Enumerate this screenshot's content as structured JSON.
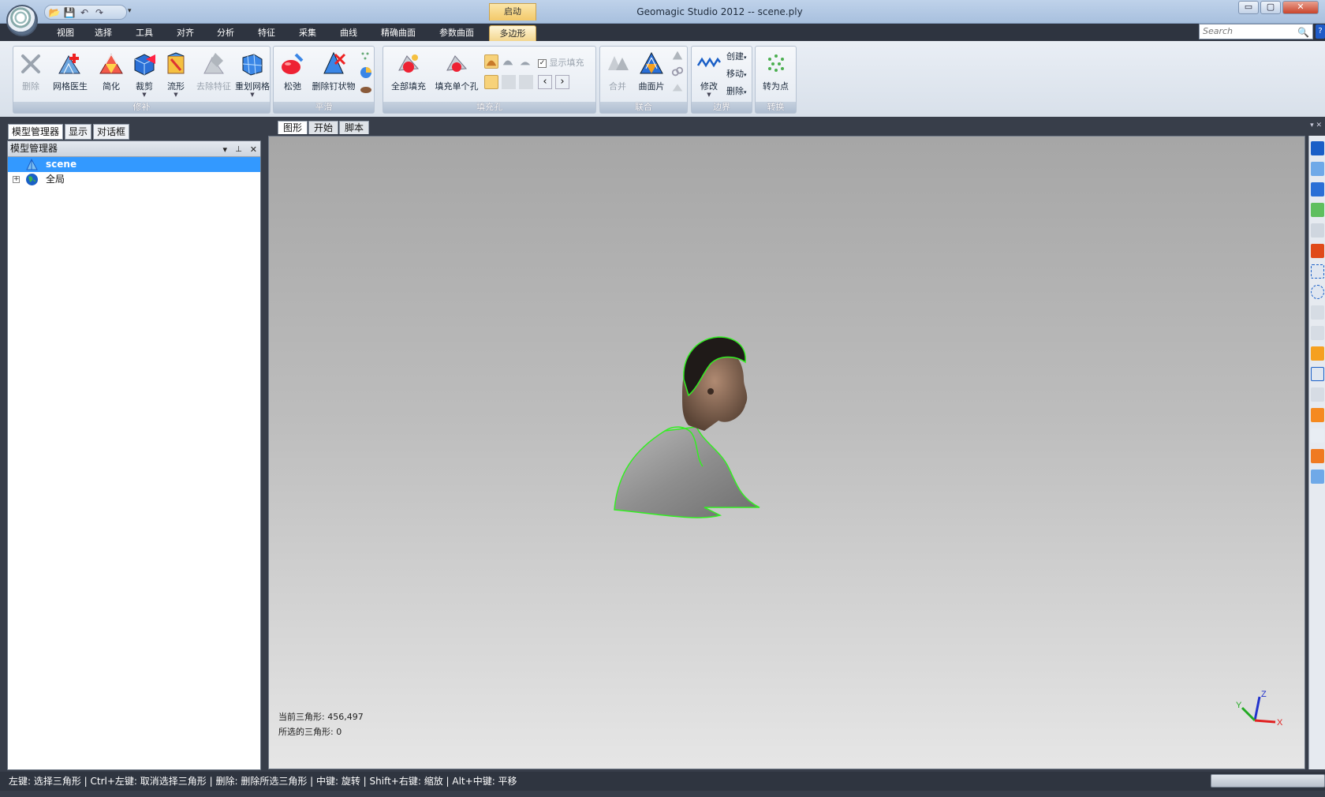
{
  "window": {
    "title": "Geomagic Studio 2012 -- scene.ply",
    "context_tab": "启动",
    "controls": {
      "minimize": "▭",
      "maximize": "▢",
      "close": "✕"
    }
  },
  "qat": {
    "more": "▾"
  },
  "ribbon_tabs": [
    {
      "label": "视图",
      "active": false
    },
    {
      "label": "选择",
      "active": false
    },
    {
      "label": "工具",
      "active": false
    },
    {
      "label": "对齐",
      "active": false
    },
    {
      "label": "分析",
      "active": false
    },
    {
      "label": "特征",
      "active": false
    },
    {
      "label": "采集",
      "active": false
    },
    {
      "label": "曲线",
      "active": false
    },
    {
      "label": "精确曲面",
      "active": false
    },
    {
      "label": "参数曲面",
      "active": false
    },
    {
      "label": "多边形",
      "active": true
    }
  ],
  "search": {
    "placeholder": "Search",
    "help": "?"
  },
  "groups": {
    "repair": {
      "label": "修补",
      "buttons": [
        "删除",
        "网格医生",
        "简化",
        "裁剪",
        "流形",
        "去除特征",
        "重划网格"
      ]
    },
    "smooth": {
      "label": "平滑",
      "buttons": [
        "松弛",
        "删除钉状物"
      ]
    },
    "fill": {
      "label": "填充孔",
      "buttons": [
        "全部填充",
        "填充单个孔"
      ],
      "show_fill": "显示填充"
    },
    "combine": {
      "label": "联合",
      "buttons": [
        "合并",
        "曲面片"
      ]
    },
    "boundary": {
      "label": "边界",
      "buttons": [
        "修改"
      ],
      "small": [
        "创建",
        "移动",
        "删除"
      ]
    },
    "convert": {
      "label": "转换",
      "buttons": [
        "转为点"
      ]
    }
  },
  "dock_tabs": [
    "模型管理器",
    "显示",
    "对话框"
  ],
  "panel": {
    "title": "模型管理器",
    "controls": [
      "▾",
      "📌",
      "✕"
    ],
    "tree": [
      {
        "label": "scene",
        "selected": true
      },
      {
        "label": "全局",
        "selected": false,
        "expander": "+"
      }
    ]
  },
  "view_tabs": [
    "图形",
    "开始",
    "脚本"
  ],
  "viewport": {
    "current_triangles": "当前三角形: 456,497",
    "selected_triangles": "所选的三角形: 0",
    "axes": {
      "x": "X",
      "y": "Y",
      "z": "Z"
    }
  },
  "statusbar": "左键: 选择三角形 | Ctrl+左键: 取消选择三角形 | 删除: 删除所选三角形 | 中键: 旋转 | Shift+右键: 缩放 | Alt+中键: 平移",
  "colors": {
    "accent": "#3399ff",
    "active_tab": "#f3d68e",
    "boundary_green": "#33ee22",
    "axis_x": "#e02020",
    "axis_y": "#22aa22",
    "axis_z": "#2233cc"
  }
}
